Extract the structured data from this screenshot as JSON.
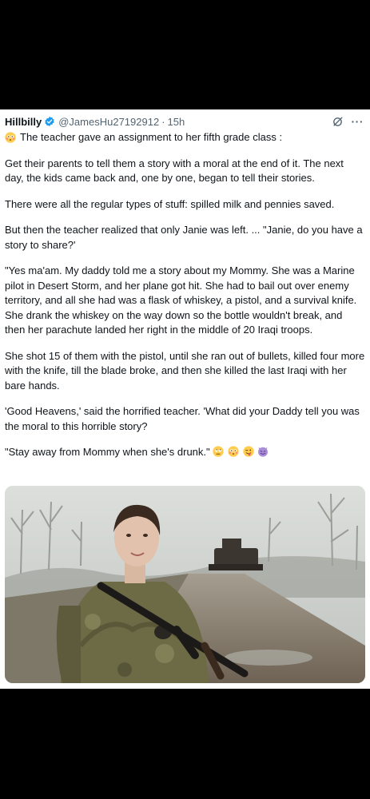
{
  "tweet": {
    "author_name": "Hillbilly",
    "handle": "@JamesHu27192912",
    "separator": "·",
    "timestamp": "15h",
    "verified": true,
    "icons": {
      "verified": "verified-badge-icon",
      "grok": "grok-icon",
      "more": "more-options-icon",
      "lead_emoji": "flushed-face-emoji"
    },
    "text": {
      "line1": "The teacher gave an assignment to her fifth grade class :",
      "p1": "Get their parents to tell them a story with a moral at the end of it. The next day, the kids came back and, one by one, began to tell their stories.",
      "p2": "There were all the regular types of stuff: spilled milk and pennies saved.",
      "p3": "But then the teacher realized that only Janie was left. ... \"Janie, do you have a story to share?'",
      "p4": "\"Yes ma'am. My daddy told me a story about my Mommy. She was a Marine pilot in Desert Storm, and her plane got hit. She had to bail out over enemy territory, and all she had was a flask of whiskey, a pistol, and a survival knife. She drank the whiskey on the way down so the bottle wouldn't break, and then her parachute landed her right in the middle of 20 Iraqi troops.",
      "p5": "She shot 15 of them with the pistol, until she ran out of bullets, killed four more with the knife, till the blade broke, and then she killed the last Iraqi with her bare hands.",
      "p6": "'Good Heavens,' said the horrified teacher. 'What did your Daddy tell you was the moral to this horrible story?",
      "p7": "\"Stay away from Mommy when she's drunk.\""
    },
    "trailing_emojis": [
      "face-with-rolling-eyes-emoji",
      "flushed-face-emoji",
      "winking-face-with-tongue-emoji",
      "smiling-face-with-horns-emoji"
    ]
  },
  "colors": {
    "text": "#0f1419",
    "muted": "#536471",
    "verified_blue": "#1d9bf0",
    "background": "#000000",
    "card": "#ffffff"
  }
}
